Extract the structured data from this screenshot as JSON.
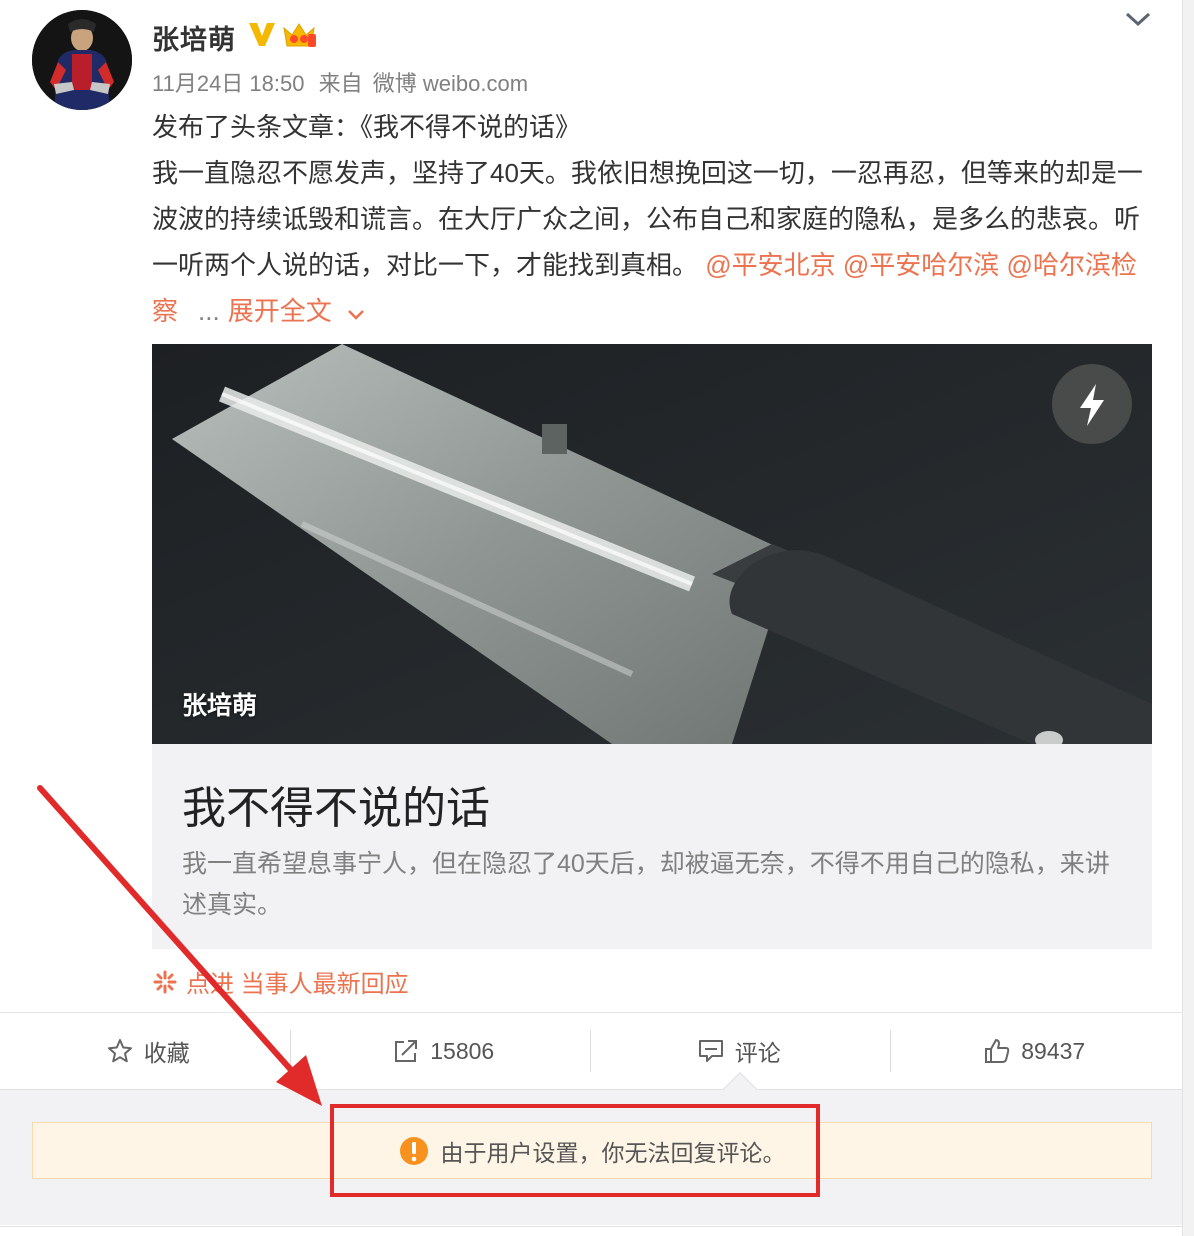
{
  "post": {
    "username": "张培萌",
    "time": "11月24日 18:50",
    "source_prefix": "来自",
    "source": "微博 weibo.com",
    "headline_line": "发布了头条文章：《我不得不说的话》",
    "body": "我一直隐忍不愿发声，坚持了40天。我依旧想挽回这一切，一忍再忍，但等来的却是一波波的持续诋毁和谎言。在大厅广众之间，公布自己和家庭的隐私，是多么的悲哀。听一听两个人说的话，对比一下，才能找到真相。",
    "mentions": [
      "@平安北京",
      "@平安哈尔滨",
      "@哈尔滨检察"
    ],
    "ellipsis": "...",
    "expand_label": "展开全文"
  },
  "card": {
    "image_author": "张培萌",
    "title": "我不得不说的话",
    "desc": "我一直希望息事宁人，但在隐忍了40天后，却被逼无奈，不得不用自己的隐私，来讲述真实。"
  },
  "news_link": "点进 当事人最新回应",
  "actions": {
    "favorite": "收藏",
    "repost_count": "15806",
    "comment": "评论",
    "like_count": "89437"
  },
  "notice": "由于用户设置，你无法回复评论。",
  "colors": {
    "accent": "#eb7350",
    "verified": "#f5b800",
    "annotation_red": "#e12b2b",
    "warning_orange": "#f7921e"
  }
}
